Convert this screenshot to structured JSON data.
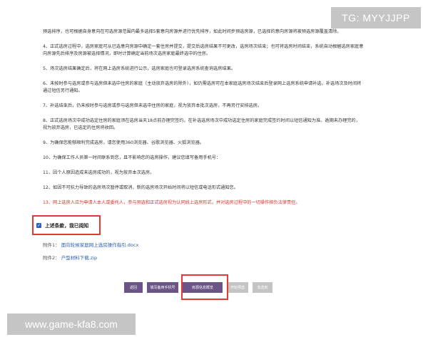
{
  "watermarks": {
    "top_right": "TG: MYYJJPP",
    "bottom_left": "www.game-kfa8.com"
  },
  "paragraphs": [
    "预选排序，也可根据自身意向在可选房源范围内最多选择5套意向房源并进行优先排序，如此时间步预选房源，已选择的意向房源将被预选房源覆盖清除。",
    "4、正式选房过程中，选房家庭可从已选意向房源中确定一套住房并提交，提交后选房结果不可更改，选房场次结束；也可将选房时间结束，系统自动根据选房家庭意向房源先后排序及房源被选择情况，即时计算确定当前场次选房家庭最终选中的住房。",
    "5、场次选房结果确定后，将在网上选房系统进行公示，选房家庭也可登录选房系统查询选房结果。",
    "6、未按时参与选房或参与选房但未选中住房的家庭（主动放弃选房的除外），如仍需选房可在本家庭选房场次结束后登录网上选房系统申请补选，补选场次及时间将通过短信另行通知。",
    "7、补选结束后，仍未按时参与选房或参与选房但未选中住房的家庭，视为放弃本批次选房，不再另行安排选房。",
    "8、正式选房场次中成功选定住房的家庭须在选房当天18点前办理完签约。在补选选房场次中成功选定住房的家庭完成签约时间以短信通知为准。逾期未办理完的，视为放弃选房，已选定的住房将收回。",
    "9、为确保您能够顺利完成选房，请您使用360浏览器、谷歌浏览器、火狐浏览器。",
    "10、为确保工作人员第一时间联系到您，且不影响您的选房操作，建议您填写备用手机号：",
    "11、因个人原因造成未选房成功的，视为放弃本次选房。",
    "12、如因不可抗力导致的选房场次暂停或取消，新的选房场次开始时间将以短信或电话形式通知您。"
  ],
  "warning_paragraph": "13、网上选房人应为申请人本人或委托人，参与预选和正式选房视为认同线上选房形式，并对选房过程中的一切操作担负法律责任。",
  "agreement": {
    "label": "上述条款，我已阅知",
    "checked": true
  },
  "attachments": [
    {
      "label": "附件1：",
      "name": "面向轮候家庭网上选房操作指引.docx"
    },
    {
      "label": "附件2：",
      "name": "户型材料下载.zip"
    }
  ],
  "buttons": [
    {
      "label": "返回",
      "state": "enabled"
    },
    {
      "label": "填写备用手机号",
      "state": "enabled"
    },
    {
      "label": "房源信息概览",
      "state": "enabled",
      "highlighted": true
    },
    {
      "label": "开始预选",
      "state": "disabled"
    },
    {
      "label": "去选房",
      "state": "disabled"
    }
  ],
  "colors": {
    "primary_button": "#6a5586",
    "disabled_button": "#c4c4c4",
    "warning_text": "#e0322a",
    "highlight_box": "#e53935",
    "link": "#2a5db0"
  }
}
